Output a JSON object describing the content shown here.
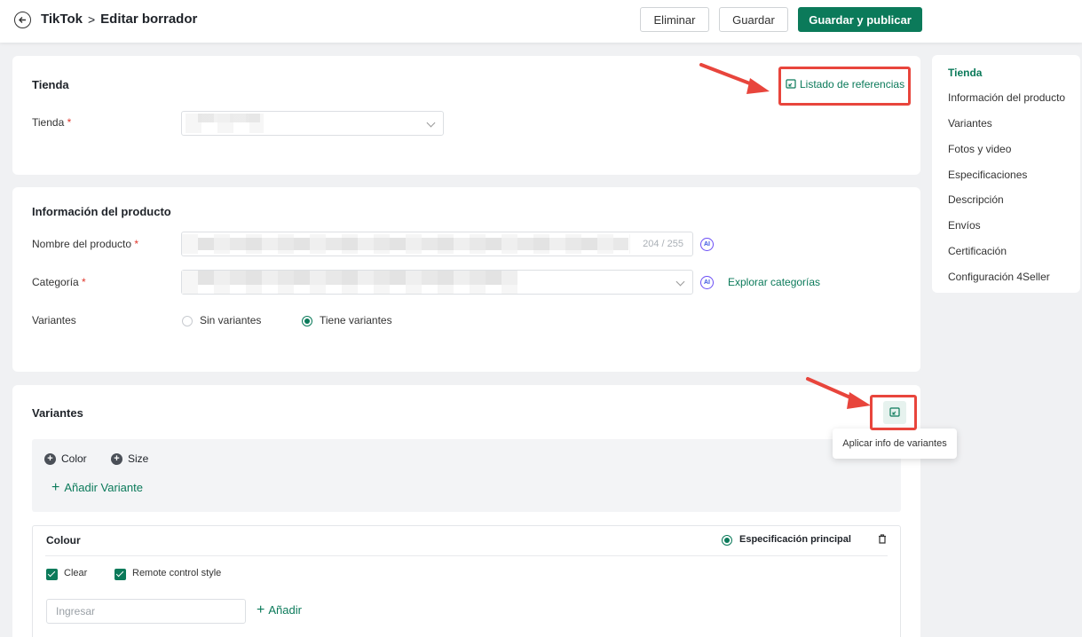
{
  "header": {
    "breadcrumb_root": "TikTok",
    "breadcrumb_sep": ">",
    "breadcrumb_current": "Editar borrador",
    "delete_label": "Eliminar",
    "save_label": "Guardar",
    "publish_label": "Guardar y publicar"
  },
  "store_section": {
    "title": "Tienda",
    "reference_link": "Listado de referencias",
    "store_label": "Tienda",
    "required_mark": "*"
  },
  "product_section": {
    "title": "Información del producto",
    "name_label": "Nombre del producto",
    "name_counter": "204 / 255",
    "category_label": "Categoría",
    "explore_link": "Explorar categorías",
    "variants_label": "Variantes",
    "no_variants": "Sin variantes",
    "has_variants": "Tiene variantes",
    "ai_badge": "AI"
  },
  "variants_section": {
    "title": "Variantes",
    "tooltip": "Aplicar info de variantes",
    "attributes": [
      "Color",
      "Size"
    ],
    "add_variant": "Añadir Variante",
    "spec_name": "Colour",
    "main_spec": "Especificación principal",
    "options": [
      "Clear",
      "Remote control style"
    ],
    "input_placeholder": "Ingresar",
    "add_label": "Añadir"
  },
  "nav": {
    "items": [
      "Tienda",
      "Información del producto",
      "Variantes",
      "Fotos y video",
      "Especificaciones",
      "Descripción",
      "Envíos",
      "Certificación",
      "Configuración 4Seller"
    ]
  },
  "colors": {
    "accent": "#0b7a5a",
    "highlight": "#e8453c"
  }
}
